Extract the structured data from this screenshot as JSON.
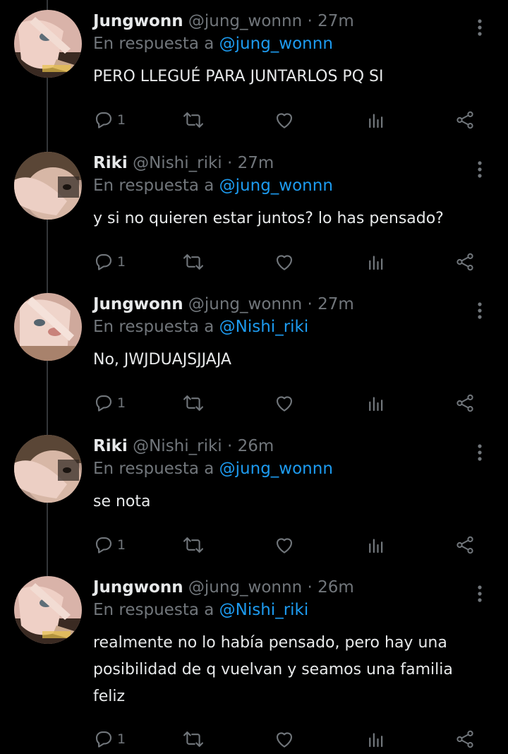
{
  "reply_prefix": "En respuesta a",
  "separator": "·",
  "tweets": [
    {
      "name": "Jungwonn",
      "handle": "@jung_wonnn",
      "time": "27m",
      "reply_to": "@jung_wonnn",
      "text": "PERO LLEGUÉ PARA JUNTARLOS PQ SI",
      "reply_count": "1"
    },
    {
      "name": "Riki",
      "handle": "@Nishi_riki",
      "time": "27m",
      "reply_to": "@jung_wonnn",
      "text": "y si no quieren estar juntos? lo has pensado?",
      "reply_count": "1"
    },
    {
      "name": "Jungwonn",
      "handle": "@jung_wonnn",
      "time": "27m",
      "reply_to": "@Nishi_riki",
      "text": "No, JWJDUAJSJJAJA",
      "reply_count": "1"
    },
    {
      "name": "Riki",
      "handle": "@Nishi_riki",
      "time": "26m",
      "reply_to": "@jung_wonnn",
      "text": "se nota",
      "reply_count": "1"
    },
    {
      "name": "Jungwonn",
      "handle": "@jung_wonnn",
      "time": "26m",
      "reply_to": "@Nishi_riki",
      "text": "realmente no lo había pensado, pero hay una posibilidad de q vuelvan y seamos una familia feliz",
      "reply_count": "1"
    }
  ],
  "icons": {
    "reply": "reply-icon",
    "retweet": "retweet-icon",
    "like": "heart-icon",
    "views": "views-icon",
    "share": "share-icon",
    "menu": "more-vertical-icon"
  },
  "colors": {
    "background": "#000000",
    "text": "#e7e9ea",
    "secondary": "#71767b",
    "link": "#1d9bf0",
    "thread_line": "#333639"
  }
}
